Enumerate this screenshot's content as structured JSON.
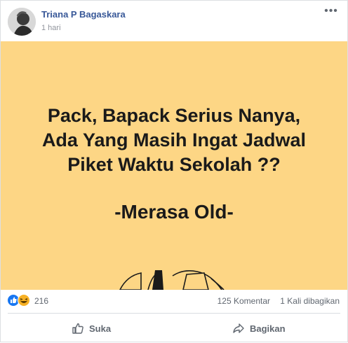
{
  "post": {
    "author": "Triana P Bagaskara",
    "timestamp": "1 hari",
    "image_text": {
      "line1": "Pack, Bapack Serius Nanya,",
      "line2": "Ada Yang Masih Ingat Jadwal",
      "line3": "Piket Waktu Sekolah ??",
      "tagline": "-Merasa Old-"
    },
    "colors": {
      "image_bg": "#fdd685",
      "link": "#385898",
      "like_blue": "#1877f2",
      "haha_yellow": "#f7b125"
    }
  },
  "stats": {
    "reactions": [
      "like-icon",
      "haha-icon"
    ],
    "reaction_count": "216",
    "comments": "125 Komentar",
    "shares": "1 Kali dibagikan"
  },
  "actions": {
    "like": "Suka",
    "share": "Bagikan"
  }
}
